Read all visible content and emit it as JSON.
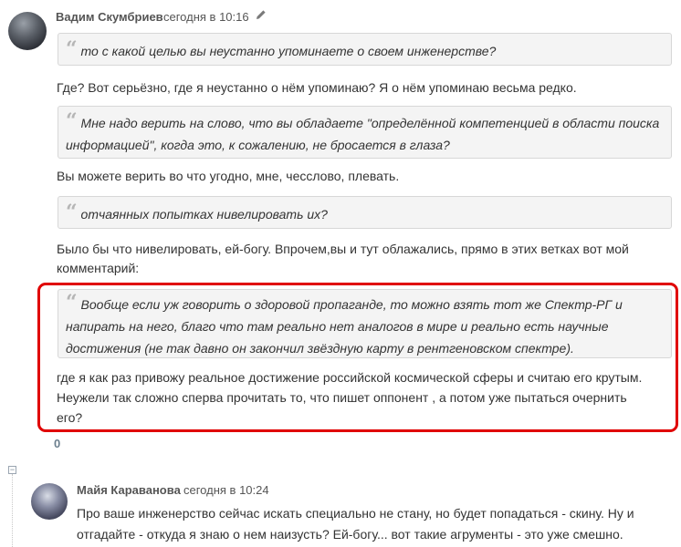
{
  "comment1": {
    "author": "Вадим Скумбриев",
    "date": "сегодня в 10:16",
    "edit_icon": "pencil-icon",
    "quote1": "то с какой целью вы неустанно упоминаете о своем инженерстве?",
    "para1": "Где? Вот серьёзно, где я неустанно о нём упоминаю? Я о нём упоминаю весьма редко.",
    "quote2_line1": "Мне надо верить на слово, что вы обладаете \"определённой компетенцией в  области поиска",
    "quote2_line2": "информацией\", когда это, к сожалению, не бросается в  глаза?",
    "para2": "Вы можете верить во что угодно, мне, чесслово, плевать.",
    "quote3": "отчаянных попытках нивелировать их?",
    "para3_line1": "Было бы что нивелировать, ей-богу. Впрочем,вы и тут облажались, прямо в этих ветках вот мой",
    "para3_line2": "комментарий:",
    "quote4_line1": "Вообще если уж говорить о здоровой пропаганде, то можно взять тот же  Спектр-РГ и",
    "quote4_line2": "напирать на него, благо что там реально нет аналогов в мире и  реально есть научные",
    "quote4_line3": "достижения (не так давно он закончил звёздную  карту в рентгеновском спектре).",
    "para4_line1": "где я как раз привожу реальное достижение российской космической сферы и считаю его крутым.",
    "para4_line2": "Неужели так сложно сперва прочитать то, что пишет оппонент , а потом уже пытаться очернить",
    "para4_line3": "его?",
    "score": "0"
  },
  "quote_mark": "“",
  "collapse_symbol": "−",
  "comment2": {
    "author": "Майя Караванова",
    "date": "сегодня в 10:24",
    "para1_line1": "Про ваше инженерство сейчас искать специально не стану, но будет попадаться - скину. Ну и",
    "para1_line2": "отгадайте - откуда я знаю о нем наизусть? Ей-богу... вот такие агрументы - это уже смешно."
  },
  "colors": {
    "highlight": "#e00000",
    "quote_bg": "#f4f4f4",
    "score": "#6b7f8e"
  }
}
